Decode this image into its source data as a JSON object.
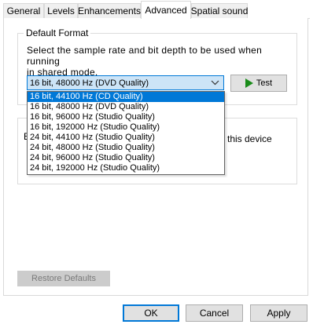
{
  "tabs": [
    {
      "label": "General"
    },
    {
      "label": "Levels"
    },
    {
      "label": "Enhancements"
    },
    {
      "label": "Advanced",
      "active": true
    },
    {
      "label": "Spatial sound"
    }
  ],
  "default_format": {
    "legend": "Default Format",
    "description_line1": "Select the sample rate and bit depth to be used when running",
    "description_line2": "in shared mode.",
    "selected_value": "16 bit, 48000 Hz (DVD Quality)",
    "test_label": "Test",
    "options": [
      {
        "label": "16 bit, 44100 Hz (CD Quality)",
        "highlighted": true
      },
      {
        "label": "16 bit, 48000 Hz (DVD Quality)"
      },
      {
        "label": "16 bit, 96000 Hz (Studio Quality)"
      },
      {
        "label": "16 bit, 192000 Hz (Studio Quality)"
      },
      {
        "label": "24 bit, 44100 Hz (Studio Quality)"
      },
      {
        "label": "24 bit, 48000 Hz (Studio Quality)"
      },
      {
        "label": "24 bit, 96000 Hz (Studio Quality)"
      },
      {
        "label": "24 bit, 192000 Hz (Studio Quality)"
      }
    ]
  },
  "exclusive_mode": {
    "legend_fragment": "E",
    "text_fragment": "this device"
  },
  "restore_defaults_label": "Restore Defaults",
  "buttons": {
    "ok": "OK",
    "cancel": "Cancel",
    "apply": "Apply"
  },
  "colors": {
    "accent": "#0078d7",
    "selection_bg": "#cce4f7",
    "play_icon": "#1a8c1a"
  }
}
